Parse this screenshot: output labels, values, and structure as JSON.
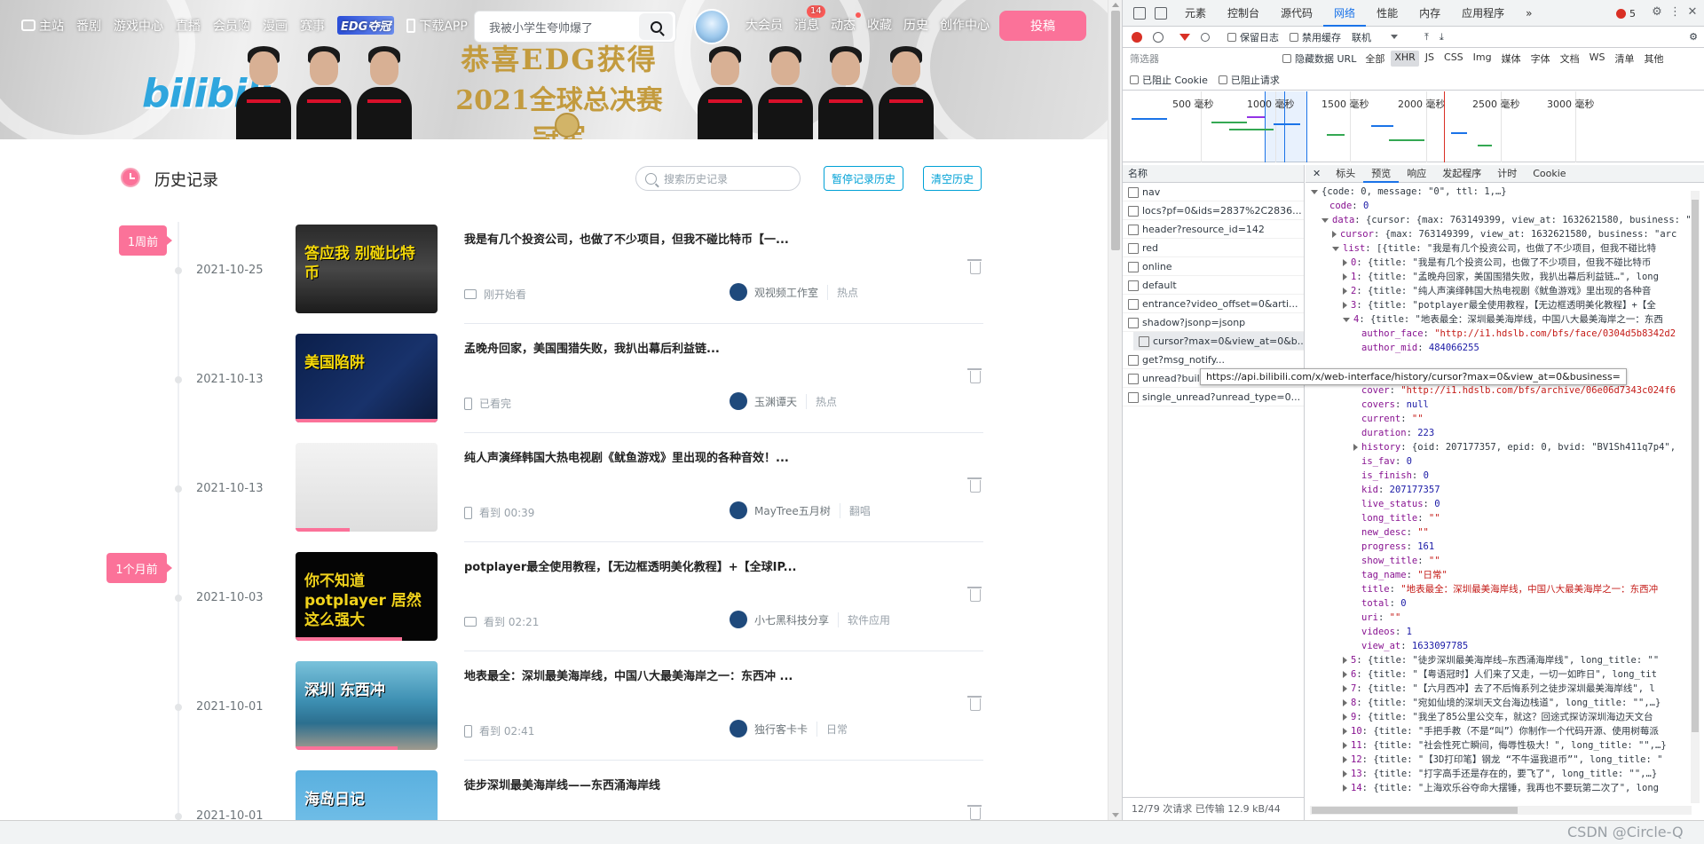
{
  "topnav": {
    "left_items": [
      "主站",
      "番剧",
      "游戏中心",
      "直播",
      "会员购",
      "漫画",
      "赛事"
    ],
    "edc_badge": "EDG夺冠",
    "download": "下载APP",
    "search_placeholder": "我被小学生夸帅爆了",
    "right_items": [
      "大会员",
      "消息",
      "动态",
      "收藏",
      "历史",
      "创作中心"
    ],
    "message_count": "14",
    "upload": "投稿"
  },
  "banner": {
    "logo": "bilibili",
    "headline_line1": "恭喜EDG获得",
    "headline_line2": "2021全球总决赛冠军"
  },
  "history": {
    "title": "历史记录",
    "search_placeholder": "搜索历史记录",
    "pause_button": "暂停记录历史",
    "clear_button": "清空历史",
    "tags": [
      "1周前",
      "1个月前"
    ],
    "entries": [
      {
        "date": "2021-10-25",
        "title": "我是有几个投资公司，也做了不少项目，但我不碰比特币【一...",
        "status": "刚开始看",
        "device": "pc",
        "up": "观视频工作室",
        "tag": "热点",
        "progress": 0,
        "thumb_text": "答应我 别碰比特币"
      },
      {
        "date": "2021-10-13",
        "title": "孟晚舟回家，美国围猎失败，我扒出幕后利益链...",
        "status": "已看完",
        "device": "phone",
        "up": "玉渊谭天",
        "tag": "热点",
        "progress": 1,
        "thumb_text": "美国陷阱"
      },
      {
        "date": "2021-10-13",
        "title": "纯人声演绎韩国大热电视剧《鱿鱼游戏》里出现的各种音效！...",
        "status": "看到 00:39",
        "device": "phone",
        "up": "MayTree五月树",
        "tag": "翻唱",
        "progress": 0.38,
        "thumb_text": ""
      },
      {
        "date": "2021-10-03",
        "title": "potplayer最全使用教程，【无边框透明美化教程】+【全球IP...",
        "status": "看到 02:21",
        "device": "pc",
        "up": "小七黑科技分享",
        "tag": "软件应用",
        "progress": 0.75,
        "thumb_text": "你不知道potplayer 居然这么强大"
      },
      {
        "date": "2021-10-01",
        "title": "地表最全：深圳最美海岸线，中国八大最美海岸之一：东西冲 ...",
        "status": "看到 02:41",
        "device": "phone",
        "up": "独行客卡卡",
        "tag": "日常",
        "progress": 0.72,
        "thumb_text": "深圳 东西冲"
      },
      {
        "date": "2021-10-01",
        "title": "徒步深圳最美海岸线——东西涌海岸线",
        "status": "",
        "device": "",
        "up": "",
        "tag": "",
        "progress": 0,
        "thumb_text": "海岛日记"
      }
    ]
  },
  "devtools": {
    "tabs": [
      "元素",
      "控制台",
      "源代码",
      "网络",
      "性能",
      "内存",
      "应用程序"
    ],
    "active_tab": "网络",
    "error_count": "5",
    "toolbar": {
      "preserve_log": "保留日志",
      "disable_cache": "禁用缓存",
      "throttle": "联机"
    },
    "filter_placeholder": "筛选器",
    "hide_data_url": "隐藏数据 URL",
    "types": [
      "全部",
      "XHR",
      "JS",
      "CSS",
      "Img",
      "媒体",
      "字体",
      "文档",
      "WS",
      "清单",
      "其他"
    ],
    "active_type": "XHR",
    "blocked_cookies": "已阻止 Cookie",
    "blocked_requests": "已阻止请求",
    "timeline_ticks": [
      "500 毫秒",
      "1000 毫秒",
      "1500 毫秒",
      "2000 毫秒",
      "2500 毫秒",
      "3000 毫秒"
    ],
    "name_header": "名称",
    "requests": [
      "nav",
      "locs?pf=0&ids=2837%2C2836...",
      "header?resource_id=142",
      "red",
      "online",
      "default",
      "entrance?video_offset=0&arti...",
      "shadow?jsonp=jsonp",
      "cursor?max=0&view_at=0&b...",
      "get?msg_notify...",
      "unread?build=0&mobi_app...",
      "single_unread?unread_type=0..."
    ],
    "selected_request": 8,
    "footer": "12/79 次请求  已传输 12.9 kB/44",
    "detail_tabs": [
      "标头",
      "预览",
      "响应",
      "发起程序",
      "计时",
      "Cookie"
    ],
    "active_detail_tab": "预览",
    "tooltip": "https://api.bilibili.com/x/web-interface/history/cursor?max=0&view_at=0&business="
  },
  "json_lines": [
    {
      "i": 0,
      "tri": "down",
      "t": "{code: 0, message: \"0\", ttl: 1,…}",
      "c": "jp"
    },
    {
      "i": 1,
      "tri": "",
      "k": "code",
      "v": "0",
      "c": "jn"
    },
    {
      "i": 1,
      "tri": "down",
      "k": "data",
      "v": "{cursor: {max: 763149399, view_at: 1632621580, business: \"arc",
      "c": "jp"
    },
    {
      "i": 2,
      "tri": "right",
      "k": "cursor",
      "v": "{max: 763149399, view_at: 1632621580, business: \"arc",
      "c": "jp"
    },
    {
      "i": 2,
      "tri": "down",
      "k": "list",
      "v": "[{title: \"我是有几个投资公司，也做了不少项目，但我不碰比特",
      "c": "jp"
    },
    {
      "i": 3,
      "tri": "right",
      "k": "0",
      "v": "{title: \"我是有几个投资公司，也做了不少项目，但我不碰比特币",
      "c": "jp"
    },
    {
      "i": 3,
      "tri": "right",
      "k": "1",
      "v": "{title: \"孟晚舟回家，美国围猎失败，我扒出幕后利益链…\", long",
      "c": "jp"
    },
    {
      "i": 3,
      "tri": "right",
      "k": "2",
      "v": "{title: \"纯人声演绎韩国大热电视剧《鱿鱼游戏》里出现的各种音",
      "c": "jp"
    },
    {
      "i": 3,
      "tri": "right",
      "k": "3",
      "v": "{title: \"potplayer最全使用教程，【无边框透明美化教程】+【全",
      "c": "jp"
    },
    {
      "i": 3,
      "tri": "down",
      "k": "4",
      "v": "{title: \"地表最全：深圳最美海岸线，中国八大最美海岸之一：东西",
      "c": "jp"
    },
    {
      "i": 4,
      "tri": "",
      "k": "author_face",
      "v": "\"http://i1.hdslb.com/bfs/face/0304d5b8342d2",
      "c": "js"
    },
    {
      "i": 4,
      "tri": "",
      "k": "author_mid",
      "v": "484066255",
      "c": "jn"
    },
    {
      "i": 4,
      "tri": "",
      "k": "",
      "v": "",
      "c": "jp"
    },
    {
      "i": 4,
      "tri": "",
      "k": "",
      "v": "",
      "c": "jp"
    },
    {
      "i": 4,
      "tri": "",
      "k": "cover",
      "v": "\"http://i1.hdslb.com/bfs/archive/06e06d7343c024f6",
      "c": "js"
    },
    {
      "i": 4,
      "tri": "",
      "k": "covers",
      "v": "null",
      "c": "jn"
    },
    {
      "i": 4,
      "tri": "",
      "k": "current",
      "v": "\"\"",
      "c": "js"
    },
    {
      "i": 4,
      "tri": "",
      "k": "duration",
      "v": "223",
      "c": "jn"
    },
    {
      "i": 4,
      "tri": "right",
      "k": "history",
      "v": "{oid: 207177357, epid: 0, bvid: \"BV1Sh411q7p4\",",
      "c": "jp"
    },
    {
      "i": 4,
      "tri": "",
      "k": "is_fav",
      "v": "0",
      "c": "jn"
    },
    {
      "i": 4,
      "tri": "",
      "k": "is_finish",
      "v": "0",
      "c": "jn"
    },
    {
      "i": 4,
      "tri": "",
      "k": "kid",
      "v": "207177357",
      "c": "jn"
    },
    {
      "i": 4,
      "tri": "",
      "k": "live_status",
      "v": "0",
      "c": "jn"
    },
    {
      "i": 4,
      "tri": "",
      "k": "long_title",
      "v": "\"\"",
      "c": "js"
    },
    {
      "i": 4,
      "tri": "",
      "k": "new_desc",
      "v": "\"\"",
      "c": "js"
    },
    {
      "i": 4,
      "tri": "",
      "k": "progress",
      "v": "161",
      "c": "jn"
    },
    {
      "i": 4,
      "tri": "",
      "k": "show_title",
      "v": "\"\"",
      "c": "js"
    },
    {
      "i": 4,
      "tri": "",
      "k": "tag_name",
      "v": "\"日常\"",
      "c": "js"
    },
    {
      "i": 4,
      "tri": "",
      "k": "title",
      "v": "\"地表最全：深圳最美海岸线，中国八大最美海岸之一：东西冲",
      "c": "js"
    },
    {
      "i": 4,
      "tri": "",
      "k": "total",
      "v": "0",
      "c": "jn"
    },
    {
      "i": 4,
      "tri": "",
      "k": "uri",
      "v": "\"\"",
      "c": "js"
    },
    {
      "i": 4,
      "tri": "",
      "k": "videos",
      "v": "1",
      "c": "jn"
    },
    {
      "i": 4,
      "tri": "",
      "k": "view_at",
      "v": "1633097785",
      "c": "jn"
    },
    {
      "i": 3,
      "tri": "right",
      "k": "5",
      "v": "{title: \"徒步深圳最美海岸线—东西涌海岸线\", long_title: \"\"",
      "c": "jp"
    },
    {
      "i": 3,
      "tri": "right",
      "k": "6",
      "v": "{title: \"【粤语冠时】人们来了又走，一切一如昨日\", long_tit",
      "c": "jp"
    },
    {
      "i": 3,
      "tri": "right",
      "k": "7",
      "v": "{title: \"【六月西冲】去了不后悔系列之徒步深圳最美海岸线\", l",
      "c": "jp"
    },
    {
      "i": 3,
      "tri": "right",
      "k": "8",
      "v": "{title: \"宛如仙境的深圳天文台海边栈道\", long_title: \"\",…}",
      "c": "jp"
    },
    {
      "i": 3,
      "tri": "right",
      "k": "9",
      "v": "{title: \"我坐了85公里公交车，就这？回途式探访深圳海边天文台",
      "c": "jp"
    },
    {
      "i": 3,
      "tri": "right",
      "k": "10",
      "v": "{title: \"手把手教（不是“叫”）你制作一个代码开源、使用树莓派",
      "c": "jp"
    },
    {
      "i": 3,
      "tri": "right",
      "k": "11",
      "v": "{title: \"社会性死亡瞬间，侮辱性极大！\", long_title: \"\",…}",
      "c": "jp"
    },
    {
      "i": 3,
      "tri": "right",
      "k": "12",
      "v": "{title: \"【3D打印笔】钢龙 “不牛逼我退币”\", long_title: \"",
      "c": "jp"
    },
    {
      "i": 3,
      "tri": "right",
      "k": "13",
      "v": "{title: \"打字高手还是存在的，要飞了\", long_title: \"\",…}",
      "c": "jp"
    },
    {
      "i": 3,
      "tri": "right",
      "k": "14",
      "v": "{title: \"上海欢乐谷夺命大摆锤，我再也不要玩第二次了\", long",
      "c": "jp"
    }
  ],
  "watermark": "CSDN @Circle-Q"
}
